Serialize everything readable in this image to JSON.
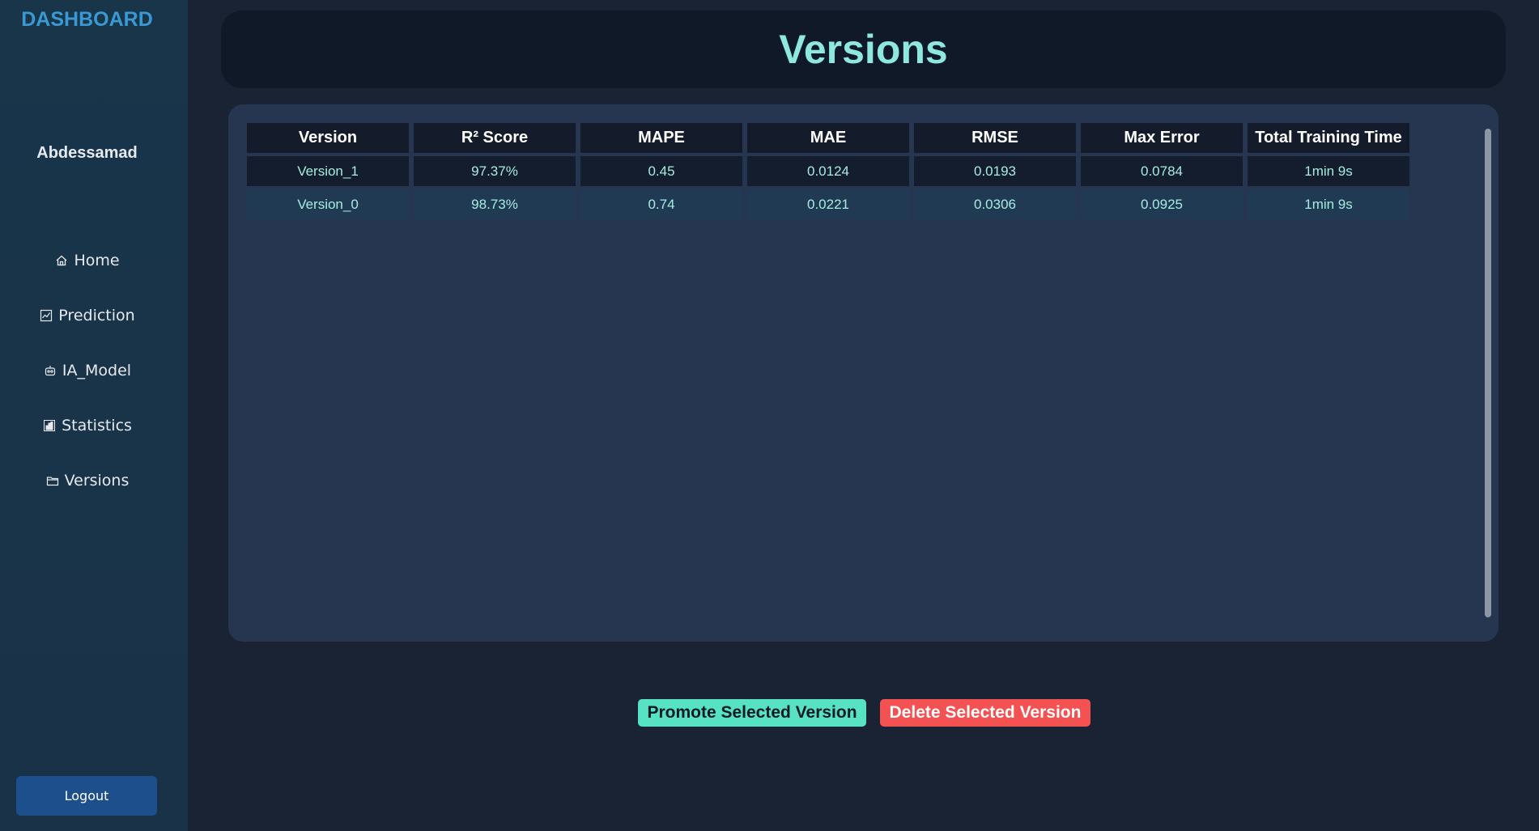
{
  "sidebar": {
    "title": "DASHBOARD",
    "user": "Abdessamad",
    "items": [
      {
        "label": "Home",
        "icon": "home-icon"
      },
      {
        "label": "Prediction",
        "icon": "chart-icon"
      },
      {
        "label": "IA_Model",
        "icon": "robot-icon"
      },
      {
        "label": "Statistics",
        "icon": "bar-chart-icon"
      },
      {
        "label": "Versions",
        "icon": "folder-icon"
      }
    ],
    "logout_label": "Logout"
  },
  "header": {
    "title": "Versions"
  },
  "table": {
    "columns": [
      "Version",
      "R² Score",
      "MAPE",
      "MAE",
      "RMSE",
      "Max Error",
      "Total Training Time"
    ],
    "rows": [
      [
        "Version_1",
        "97.37%",
        "0.45",
        "0.0124",
        "0.0193",
        "0.0784",
        "1min 9s"
      ],
      [
        "Version_0",
        "98.73%",
        "0.74",
        "0.0221",
        "0.0306",
        "0.0925",
        "1min 9s"
      ]
    ]
  },
  "actions": {
    "promote_label": "Promote Selected Version",
    "delete_label": "Delete Selected Version"
  },
  "colors": {
    "accent": "#8fe8e0",
    "promote": "#57e2c3",
    "delete": "#f35152",
    "logout": "#1e4f8d"
  }
}
